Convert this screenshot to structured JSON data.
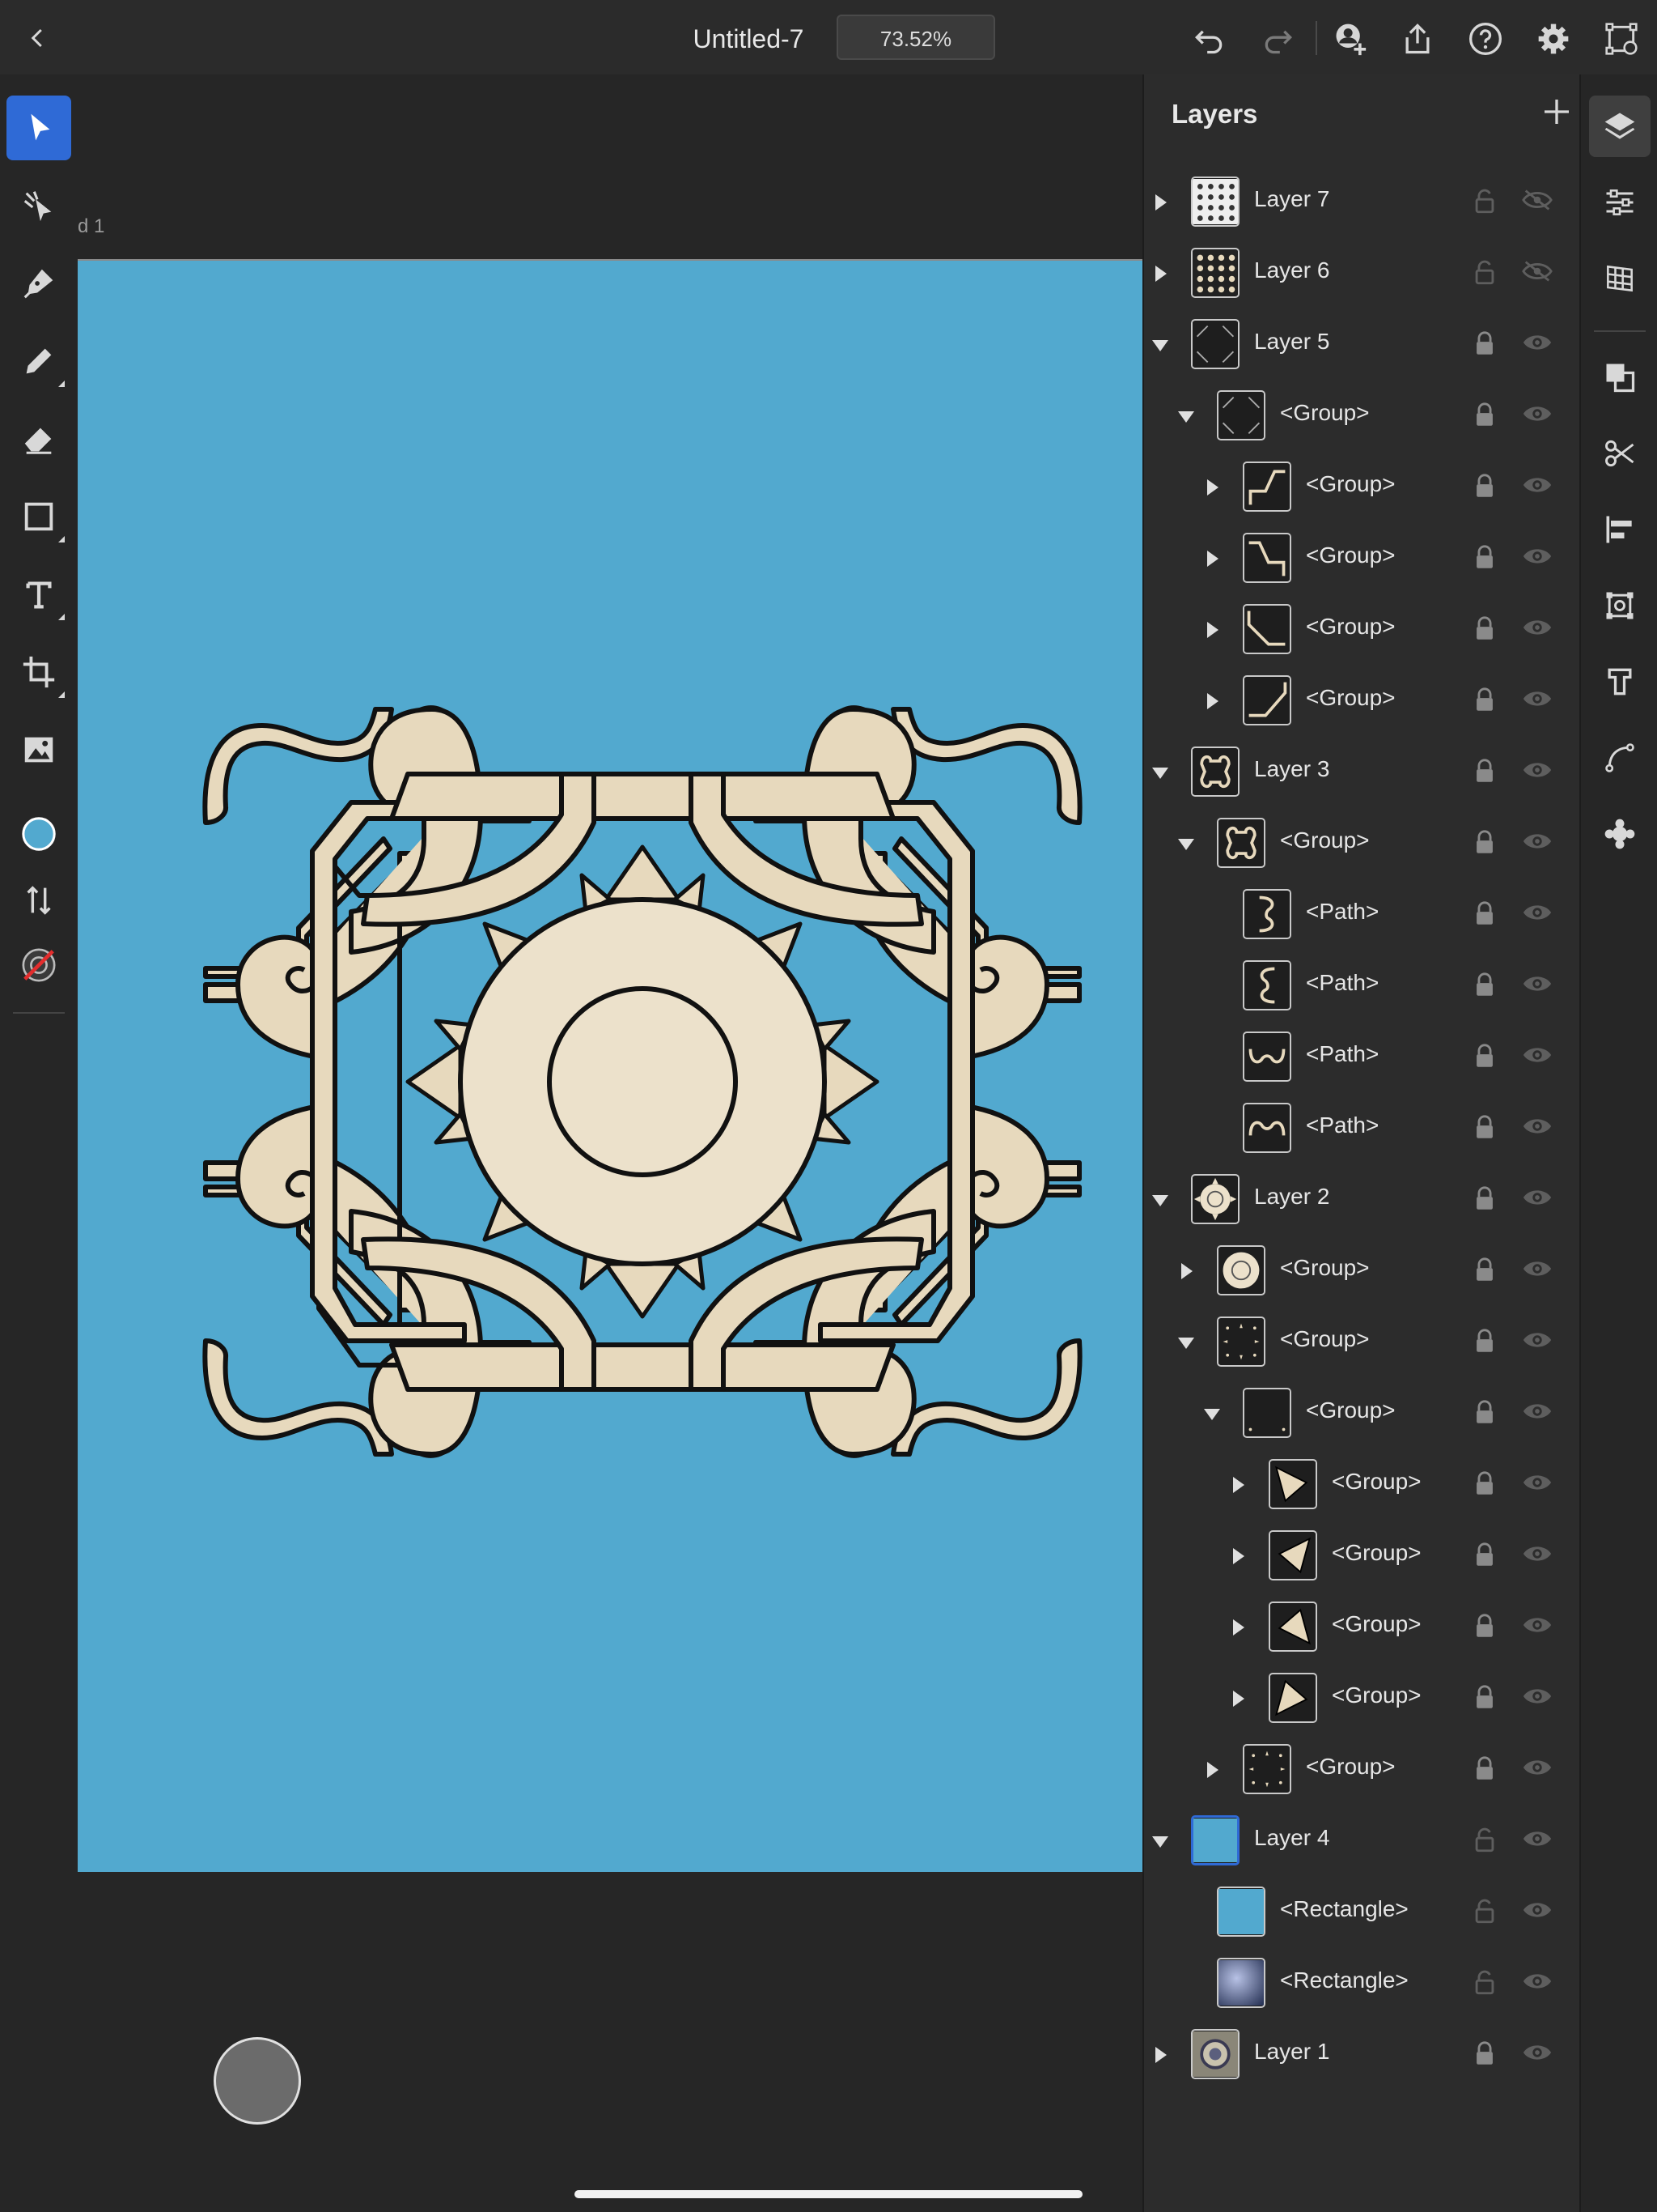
{
  "header": {
    "title": "Untitled-7",
    "zoom": "73.52%"
  },
  "canvas": {
    "artboard_label": "d 1",
    "artboard_color": "#52a9cf",
    "fill_color": "#52a9cf",
    "art_fill": "#e7d9bd",
    "art_stroke": "#111111"
  },
  "layers_panel": {
    "title": "Layers",
    "rows": [
      {
        "label": "Layer 7",
        "depth": 0,
        "expand": "collapsed",
        "thumb": "dots-grid",
        "locked": false,
        "visible": false
      },
      {
        "label": "Layer 6",
        "depth": 0,
        "expand": "collapsed",
        "thumb": "dots-grid-dark",
        "locked": false,
        "visible": false
      },
      {
        "label": "Layer 5",
        "depth": 0,
        "expand": "expanded",
        "thumb": "corners",
        "locked": true,
        "visible": true
      },
      {
        "label": "<Group>",
        "depth": 1,
        "expand": "expanded",
        "thumb": "corners",
        "locked": true,
        "visible": true
      },
      {
        "label": "<Group>",
        "depth": 2,
        "expand": "collapsed",
        "thumb": "corner-tr",
        "locked": true,
        "visible": true
      },
      {
        "label": "<Group>",
        "depth": 2,
        "expand": "collapsed",
        "thumb": "corner-tl",
        "locked": true,
        "visible": true
      },
      {
        "label": "<Group>",
        "depth": 2,
        "expand": "collapsed",
        "thumb": "corner-bl",
        "locked": true,
        "visible": true
      },
      {
        "label": "<Group>",
        "depth": 2,
        "expand": "collapsed",
        "thumb": "corner-br",
        "locked": true,
        "visible": true
      },
      {
        "label": "Layer 3",
        "depth": 0,
        "expand": "expanded",
        "thumb": "knot",
        "locked": true,
        "visible": true
      },
      {
        "label": "<Group>",
        "depth": 1,
        "expand": "expanded",
        "thumb": "knot",
        "locked": true,
        "visible": true
      },
      {
        "label": "<Path>",
        "depth": 2,
        "expand": "none",
        "thumb": "path-l",
        "locked": true,
        "visible": true
      },
      {
        "label": "<Path>",
        "depth": 2,
        "expand": "none",
        "thumb": "path-r",
        "locked": true,
        "visible": true
      },
      {
        "label": "<Path>",
        "depth": 2,
        "expand": "none",
        "thumb": "path-b",
        "locked": true,
        "visible": true
      },
      {
        "label": "<Path>",
        "depth": 2,
        "expand": "none",
        "thumb": "path-t",
        "locked": true,
        "visible": true
      },
      {
        "label": "Layer 2",
        "depth": 0,
        "expand": "expanded",
        "thumb": "sun",
        "locked": true,
        "visible": true
      },
      {
        "label": "<Group>",
        "depth": 1,
        "expand": "collapsed",
        "thumb": "circle",
        "locked": true,
        "visible": true
      },
      {
        "label": "<Group>",
        "depth": 1,
        "expand": "expanded",
        "thumb": "points",
        "locked": true,
        "visible": true
      },
      {
        "label": "<Group>",
        "depth": 2,
        "expand": "expanded",
        "thumb": "empty",
        "locked": true,
        "visible": true
      },
      {
        "label": "<Group>",
        "depth": 3,
        "expand": "collapsed",
        "thumb": "tri-a",
        "locked": true,
        "visible": true
      },
      {
        "label": "<Group>",
        "depth": 3,
        "expand": "collapsed",
        "thumb": "tri-b",
        "locked": true,
        "visible": true
      },
      {
        "label": "<Group>",
        "depth": 3,
        "expand": "collapsed",
        "thumb": "tri-c",
        "locked": true,
        "visible": true
      },
      {
        "label": "<Group>",
        "depth": 3,
        "expand": "collapsed",
        "thumb": "tri-d",
        "locked": true,
        "visible": true
      },
      {
        "label": "<Group>",
        "depth": 2,
        "expand": "collapsed",
        "thumb": "points",
        "locked": true,
        "visible": true
      },
      {
        "label": "Layer 4",
        "depth": 0,
        "expand": "expanded",
        "thumb": "blue",
        "locked": false,
        "visible": true,
        "selected": true
      },
      {
        "label": "<Rectangle>",
        "depth": 1,
        "expand": "none",
        "thumb": "blue",
        "locked": false,
        "visible": true
      },
      {
        "label": "<Rectangle>",
        "depth": 1,
        "expand": "none",
        "thumb": "gradient",
        "locked": false,
        "visible": true
      },
      {
        "label": "Layer 1",
        "depth": 0,
        "expand": "collapsed",
        "thumb": "photo",
        "locked": true,
        "visible": true
      }
    ]
  },
  "left_toolbar": [
    "selection-tool",
    "direct-select-tool",
    "pen-tool",
    "pencil-tool",
    "eraser-tool",
    "shape-tool",
    "type-tool",
    "transform-tool",
    "place-image-tool",
    "fill-swatch",
    "swap-colors",
    "stroke-swatch"
  ],
  "right_rail": [
    "layers",
    "properties",
    "grid",
    "combine-shapes",
    "scissors",
    "align",
    "transform",
    "type-settings",
    "path",
    "symbols"
  ]
}
